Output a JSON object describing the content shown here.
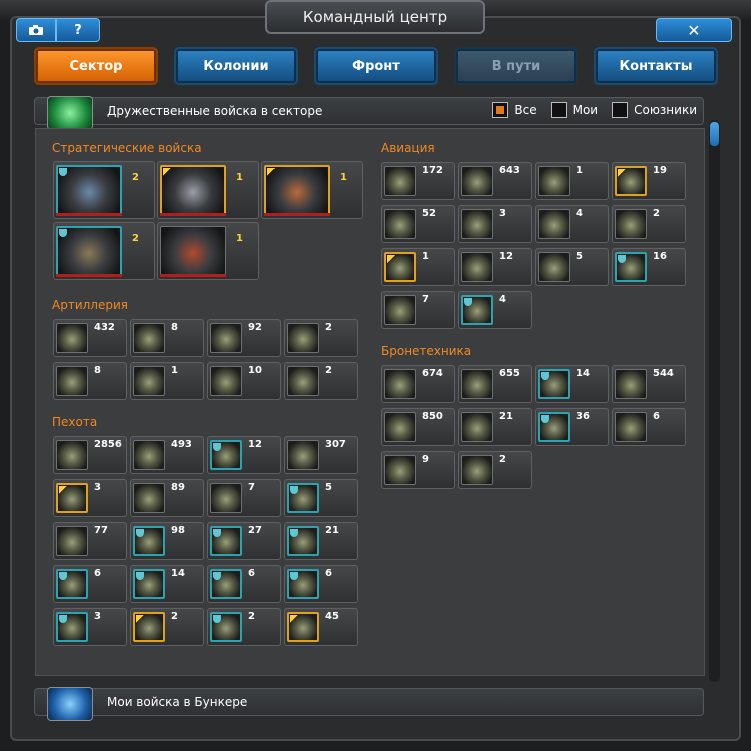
{
  "window": {
    "title": "Командный центр"
  },
  "top_buttons": {
    "help_label": "?",
    "close_label": "✕"
  },
  "tabs": [
    {
      "label": "Сектор",
      "state": "active"
    },
    {
      "label": "Колонии",
      "state": "normal"
    },
    {
      "label": "Фронт",
      "state": "normal"
    },
    {
      "label": "В пути",
      "state": "disabled"
    },
    {
      "label": "Контакты",
      "state": "normal"
    }
  ],
  "friendly_section": {
    "title": "Дружественные войска в секторе",
    "filters": [
      {
        "label": "Все",
        "checked": true
      },
      {
        "label": "Мои",
        "checked": false
      },
      {
        "label": "Союзники",
        "checked": false
      }
    ]
  },
  "categories": {
    "strategic": {
      "title": "Стратегические войска",
      "units": [
        {
          "count": "2",
          "badge": "shield",
          "tint": "#6a8aa8"
        },
        {
          "count": "1",
          "badge": "elite",
          "tint": "#9a9ea6"
        },
        {
          "count": "1",
          "badge": "elite",
          "tint": "#b86a3a"
        },
        {
          "count": "2",
          "badge": "shield",
          "tint": "#8a7a58"
        },
        {
          "count": "1",
          "badge": "none",
          "tint": "#b04a30"
        }
      ]
    },
    "artillery": {
      "title": "Артиллерия",
      "units": [
        {
          "count": "432",
          "badge": "none"
        },
        {
          "count": "8",
          "badge": "none"
        },
        {
          "count": "92",
          "badge": "none"
        },
        {
          "count": "2",
          "badge": "none"
        },
        {
          "count": "8",
          "badge": "none"
        },
        {
          "count": "1",
          "badge": "none"
        },
        {
          "count": "10",
          "badge": "none"
        },
        {
          "count": "2",
          "badge": "none"
        }
      ]
    },
    "infantry": {
      "title": "Пехота",
      "units": [
        {
          "count": "2856",
          "badge": "none"
        },
        {
          "count": "493",
          "badge": "none"
        },
        {
          "count": "12",
          "badge": "shield"
        },
        {
          "count": "307",
          "badge": "none"
        },
        {
          "count": "3",
          "badge": "elite"
        },
        {
          "count": "89",
          "badge": "none"
        },
        {
          "count": "7",
          "badge": "none"
        },
        {
          "count": "5",
          "badge": "shield"
        },
        {
          "count": "77",
          "badge": "none"
        },
        {
          "count": "98",
          "badge": "shield"
        },
        {
          "count": "27",
          "badge": "shield"
        },
        {
          "count": "21",
          "badge": "shield"
        },
        {
          "count": "6",
          "badge": "shield"
        },
        {
          "count": "14",
          "badge": "shield"
        },
        {
          "count": "6",
          "badge": "shield"
        },
        {
          "count": "6",
          "badge": "shield"
        },
        {
          "count": "3",
          "badge": "shield"
        },
        {
          "count": "2",
          "badge": "elite"
        },
        {
          "count": "2",
          "badge": "shield"
        },
        {
          "count": "45",
          "badge": "elite"
        }
      ]
    },
    "aviation": {
      "title": "Авиация",
      "units": [
        {
          "count": "172",
          "badge": "none"
        },
        {
          "count": "643",
          "badge": "none"
        },
        {
          "count": "1",
          "badge": "none"
        },
        {
          "count": "19",
          "badge": "elite"
        },
        {
          "count": "52",
          "badge": "none"
        },
        {
          "count": "3",
          "badge": "none"
        },
        {
          "count": "4",
          "badge": "none"
        },
        {
          "count": "2",
          "badge": "none"
        },
        {
          "count": "1",
          "badge": "elite"
        },
        {
          "count": "12",
          "badge": "none"
        },
        {
          "count": "5",
          "badge": "none"
        },
        {
          "count": "16",
          "badge": "shield"
        },
        {
          "count": "7",
          "badge": "none"
        },
        {
          "count": "4",
          "badge": "shield"
        }
      ]
    },
    "armor": {
      "title": "Бронетехника",
      "units": [
        {
          "count": "674",
          "badge": "none"
        },
        {
          "count": "655",
          "badge": "none"
        },
        {
          "count": "14",
          "badge": "shield"
        },
        {
          "count": "544",
          "badge": "none"
        },
        {
          "count": "850",
          "badge": "none"
        },
        {
          "count": "21",
          "badge": "none"
        },
        {
          "count": "36",
          "badge": "shield"
        },
        {
          "count": "6",
          "badge": "none"
        },
        {
          "count": "9",
          "badge": "none"
        },
        {
          "count": "2",
          "badge": "none"
        }
      ]
    }
  },
  "bunker_section": {
    "title": "Мои войска в Бункере"
  },
  "icons": {
    "camera": "camera-icon",
    "help": "help-icon",
    "close": "close-icon",
    "friendly": "green-flag-icon",
    "bunker": "blue-bunker-icon"
  },
  "colors": {
    "accent": "#f28a22",
    "tab_blue": "#1f6fb4",
    "tab_active": "#e87012",
    "elite": "#e0a21a",
    "shield": "#2ba3b0"
  }
}
